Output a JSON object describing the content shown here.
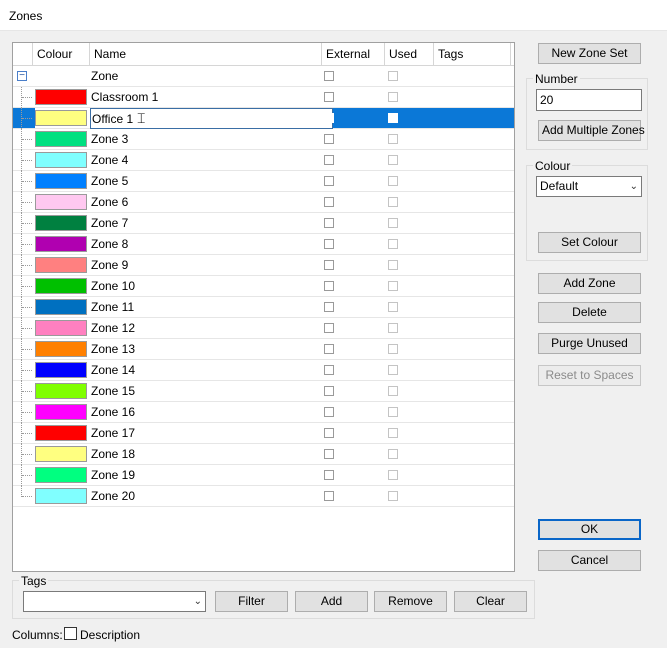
{
  "window": {
    "title": "Zones"
  },
  "grid": {
    "columns": [
      "Colour",
      "Name",
      "External",
      "Used",
      "Tags"
    ],
    "group_row": {
      "label": "Zone",
      "expander": "−"
    },
    "rows": [
      {
        "name": "Classroom 1",
        "color": "#ff0000",
        "selected": false
      },
      {
        "name": "Office 1",
        "color": "#ffff80",
        "selected": true
      },
      {
        "name": "Zone 3",
        "color": "#00e080",
        "selected": false
      },
      {
        "name": "Zone 4",
        "color": "#80ffff",
        "selected": false
      },
      {
        "name": "Zone 5",
        "color": "#0080ff",
        "selected": false
      },
      {
        "name": "Zone 6",
        "color": "#ffc8f0",
        "selected": false
      },
      {
        "name": "Zone 7",
        "color": "#008040",
        "selected": false
      },
      {
        "name": "Zone 8",
        "color": "#b000b0",
        "selected": false
      },
      {
        "name": "Zone 9",
        "color": "#ff8080",
        "selected": false
      },
      {
        "name": "Zone 10",
        "color": "#00c000",
        "selected": false
      },
      {
        "name": "Zone 11",
        "color": "#0070c0",
        "selected": false
      },
      {
        "name": "Zone 12",
        "color": "#ff80c0",
        "selected": false
      },
      {
        "name": "Zone 13",
        "color": "#ff8000",
        "selected": false
      },
      {
        "name": "Zone 14",
        "color": "#0000ff",
        "selected": false
      },
      {
        "name": "Zone 15",
        "color": "#80ff00",
        "selected": false
      },
      {
        "name": "Zone 16",
        "color": "#ff00ff",
        "selected": false
      },
      {
        "name": "Zone 17",
        "color": "#ff0000",
        "selected": false
      },
      {
        "name": "Zone 18",
        "color": "#ffff80",
        "selected": false
      },
      {
        "name": "Zone 19",
        "color": "#00ff80",
        "selected": false
      },
      {
        "name": "Zone 20",
        "color": "#80ffff",
        "selected": false
      }
    ]
  },
  "right_panel": {
    "new_zone_set": "New Zone Set",
    "number_group": {
      "label": "Number",
      "value": "20",
      "add_multiple": "Add Multiple Zones"
    },
    "colour_group": {
      "label": "Colour",
      "selected": "Default",
      "set_colour": "Set Colour"
    },
    "add_zone": "Add Zone",
    "delete": "Delete",
    "purge_unused": "Purge Unused",
    "reset_to_spaces": "Reset to Spaces",
    "ok": "OK",
    "cancel": "Cancel"
  },
  "tags_group": {
    "label": "Tags",
    "select_value": "",
    "filter": "Filter",
    "add": "Add",
    "remove": "Remove",
    "clear": "Clear"
  },
  "columns_bar": {
    "label": "Columns:",
    "description": "Description"
  },
  "colors": {
    "selection": "#0b78d7",
    "ok_border": "#0a66c8"
  }
}
